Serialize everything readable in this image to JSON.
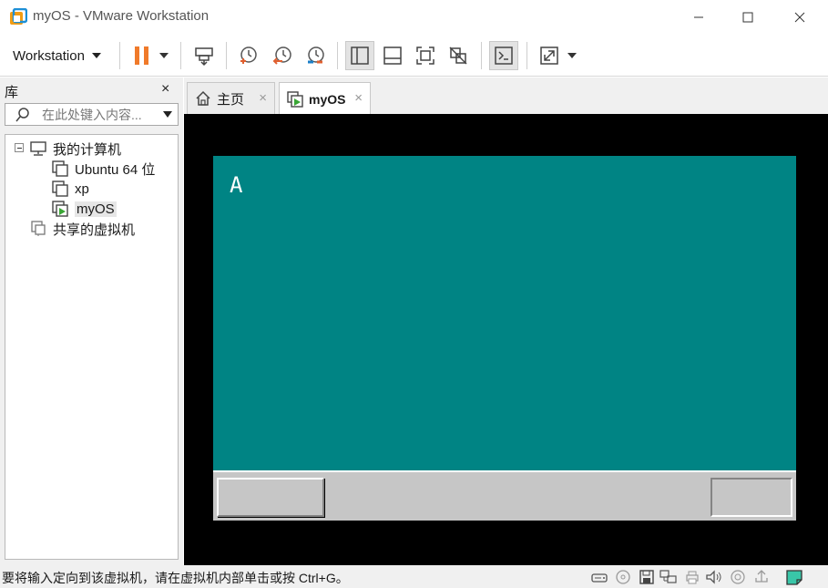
{
  "window": {
    "title": "myOS - VMware Workstation",
    "controls": [
      "minimize",
      "maximize",
      "close"
    ]
  },
  "toolbar": {
    "menu_label": "Workstation",
    "buttons": [
      {
        "name": "pause-icon",
        "color": "#f07a2a"
      },
      {
        "name": "send-ctrl-alt-del-icon"
      },
      {
        "name": "snapshot-take-icon"
      },
      {
        "name": "snapshot-revert-icon"
      },
      {
        "name": "snapshot-manager-icon"
      },
      {
        "name": "library-view-icon",
        "active": true
      },
      {
        "name": "thumbnail-bar-icon"
      },
      {
        "name": "fullscreen-icon"
      },
      {
        "name": "unity-icon"
      },
      {
        "name": "console-view-icon",
        "active": true
      },
      {
        "name": "stretch-guest-icon"
      }
    ]
  },
  "library": {
    "title": "库",
    "close": "×",
    "search_placeholder": "在此处键入内容...",
    "tree": {
      "root": "我的计算机",
      "vms": [
        "Ubuntu 64 位",
        "xp",
        "myOS"
      ],
      "selected": "myOS",
      "shared": "共享的虚拟机"
    }
  },
  "tabs": [
    {
      "label": "主页",
      "icon": "home-icon",
      "active": false
    },
    {
      "label": "myOS",
      "icon": "vm-running-icon",
      "active": true
    }
  ],
  "guest": {
    "background": "#008484",
    "glyph": "A"
  },
  "statusbar": {
    "hint": "要将输入定向到该虚拟机，请在虚拟机内部单击或按 Ctrl+G。",
    "device_icons": [
      "hard-disk-icon",
      "cd-dvd-icon",
      "floppy-icon",
      "network-icon",
      "printer-icon",
      "sound-icon",
      "camera-icon",
      "usb-icon",
      "message-icon"
    ]
  }
}
